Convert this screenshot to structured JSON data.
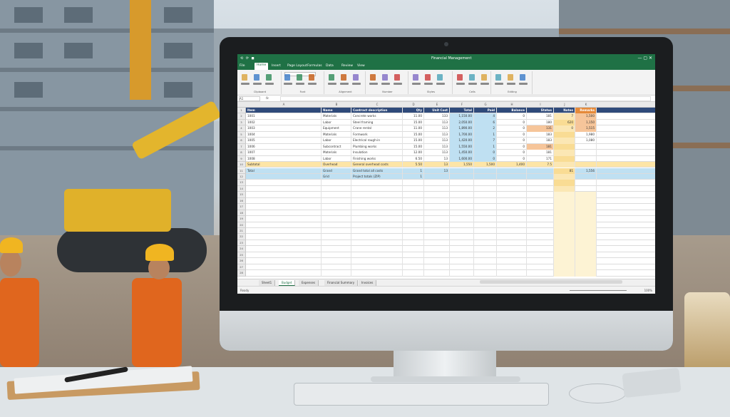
{
  "colors": {
    "excel_green": "#1f7145",
    "header_navy": "#2f4a7a",
    "row_yellow": "#fde5a6",
    "row_blue": "#bfe0f2",
    "row_orange": "#f6c59a",
    "accent_orange": "#e58a3a"
  },
  "excel": {
    "title": "Financial Management",
    "quick_access": "⟲ ⟳ ◼",
    "window_controls": "— ▢ ✕",
    "tabs": [
      "File",
      "Home",
      "Insert",
      "Page Layout",
      "Formulas",
      "Data",
      "Review",
      "View"
    ],
    "active_tab": "Home",
    "ribbon_groups": [
      "Clipboard",
      "Font",
      "Alignment",
      "Number",
      "Styles",
      "Cells",
      "Editing"
    ],
    "name_box": "A1",
    "fx": "fx",
    "columns": [
      "A",
      "B",
      "C",
      "D",
      "E",
      "F",
      "G",
      "H",
      "I",
      "J",
      "K"
    ],
    "header_row": [
      "Item",
      "Name",
      "Description",
      "Qty",
      "Unit Cost",
      "Total",
      "Paid",
      "Balance",
      "Status",
      "Notes",
      ""
    ],
    "rows": [
      [
        "Item",
        "Name",
        "Contract description",
        "Qty",
        "Unit Cost",
        "Total",
        "Paid",
        "Balance",
        "Status",
        "Notes",
        "Remarks"
      ],
      [
        "1001",
        "Materials",
        "Concrete works",
        "11.00",
        "133",
        "1,150.00",
        "4",
        "0",
        "181",
        "7",
        "1,500"
      ],
      [
        "1002",
        "Labor",
        "Steel framing",
        "15.00",
        "113",
        "2,050.00",
        "6",
        "0",
        "180",
        "620",
        "1,150"
      ],
      [
        "1003",
        "Equipment",
        "Crane rental",
        "11.00",
        "113",
        "1,890.00",
        "2",
        "0",
        "131",
        "0",
        "1,515"
      ],
      [
        "1004",
        "Materials",
        "Formwork",
        "15.00",
        "113",
        "1,700.00",
        "1",
        "0",
        "183",
        "",
        "1,980"
      ],
      [
        "1005",
        "Labor",
        "Electrical rough-in",
        "15.00",
        "113",
        "1,420.00",
        "7",
        "0",
        "183",
        "",
        "1,080"
      ],
      [
        "1006",
        "Subcontract",
        "Plumbing works",
        "15.00",
        "113",
        "1,550.00",
        "1",
        "0",
        "181",
        "",
        ""
      ],
      [
        "1007",
        "Materials",
        "Insulation",
        "12.00",
        "113",
        "1,450.00",
        "0",
        "0",
        "181",
        "",
        ""
      ],
      [
        "1008",
        "Labor",
        "Finishing works",
        "6.50",
        "13",
        "1,600.00",
        "0",
        "0",
        "171",
        "",
        ""
      ],
      [
        "Subtotal",
        "Overhead",
        "General overhead costs",
        "5.50",
        "13",
        "1,550",
        "1,500",
        "1,400",
        "7.5",
        "",
        ""
      ],
      [
        "Total",
        "Grand",
        "Grand total all costs",
        "1",
        "13",
        "",
        "",
        "",
        "",
        "81",
        "1,556"
      ],
      [
        "",
        "Grid",
        "Project totals (ZIP)",
        "1",
        "",
        "",
        "",
        "",
        "",
        "",
        ""
      ]
    ],
    "sheet_tabs": [
      "Sheet1",
      "Budget",
      "Expenses",
      "Financial Summary",
      "Invoices"
    ],
    "active_sheet": "Budget",
    "status": "Ready",
    "zoom": "100%"
  }
}
